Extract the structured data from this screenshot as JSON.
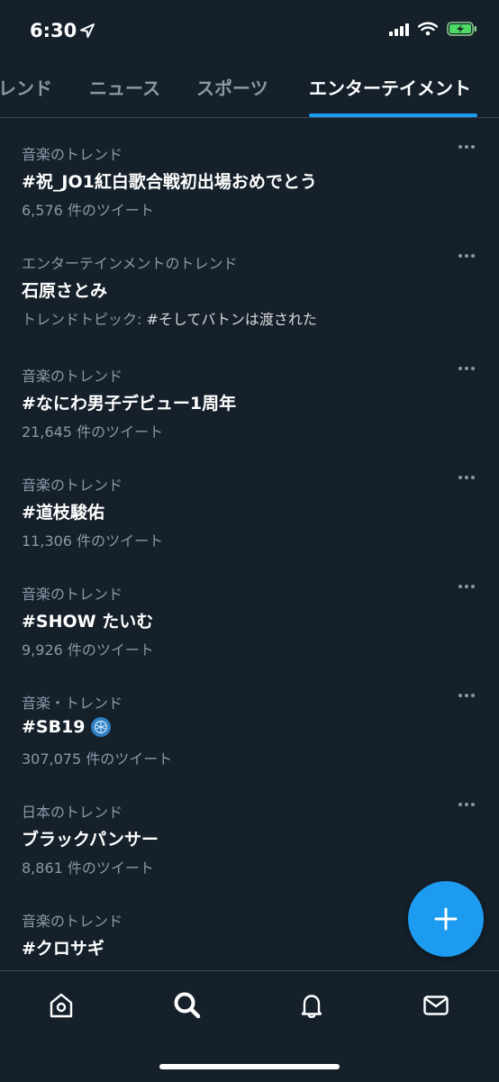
{
  "status_bar": {
    "time": "6:30"
  },
  "tabs": [
    {
      "label": "レンド"
    },
    {
      "label": "ニュース"
    },
    {
      "label": "スポーツ"
    },
    {
      "label": "エンターテイメント",
      "active": true
    }
  ],
  "trends": [
    {
      "category": "音楽のトレンド",
      "title": "#祝_JO1紅白歌合戦初出場おめでとう",
      "meta": "6,576 件のツイート"
    },
    {
      "category": "エンターテインメントのトレンド",
      "title": "石原さとみ",
      "meta_prefix": "トレンドトピック: ",
      "meta_topic": "#そしてバトンは渡された"
    },
    {
      "category": "音楽のトレンド",
      "title": "#なにわ男子デビュー1周年",
      "meta": "21,645 件のツイート"
    },
    {
      "category": "音楽のトレンド",
      "title": "#道枝駿佑",
      "meta": "11,306 件のツイート"
    },
    {
      "category": "音楽のトレンド",
      "title": "#SHOW たいむ",
      "meta": "9,926 件のツイート"
    },
    {
      "category": "音楽・トレンド",
      "title": "#SB19",
      "meta": "307,075 件のツイート",
      "badge_icon": "sb19-hashflag-icon"
    },
    {
      "category": "日本のトレンド",
      "title": "ブラックパンサー",
      "meta": "8,861 件のツイート"
    },
    {
      "category": "音楽のトレンド",
      "title": "#クロサギ",
      "meta": ""
    }
  ],
  "bottom_nav": [
    {
      "icon": "home-icon"
    },
    {
      "icon": "search-icon"
    },
    {
      "icon": "notifications-icon"
    },
    {
      "icon": "messages-icon"
    }
  ],
  "fab": {
    "icon": "plus-icon"
  },
  "colors": {
    "background": "#15202b",
    "accent": "#1d9bf0",
    "secondary_text": "#8899a6",
    "divider": "#38444d"
  }
}
